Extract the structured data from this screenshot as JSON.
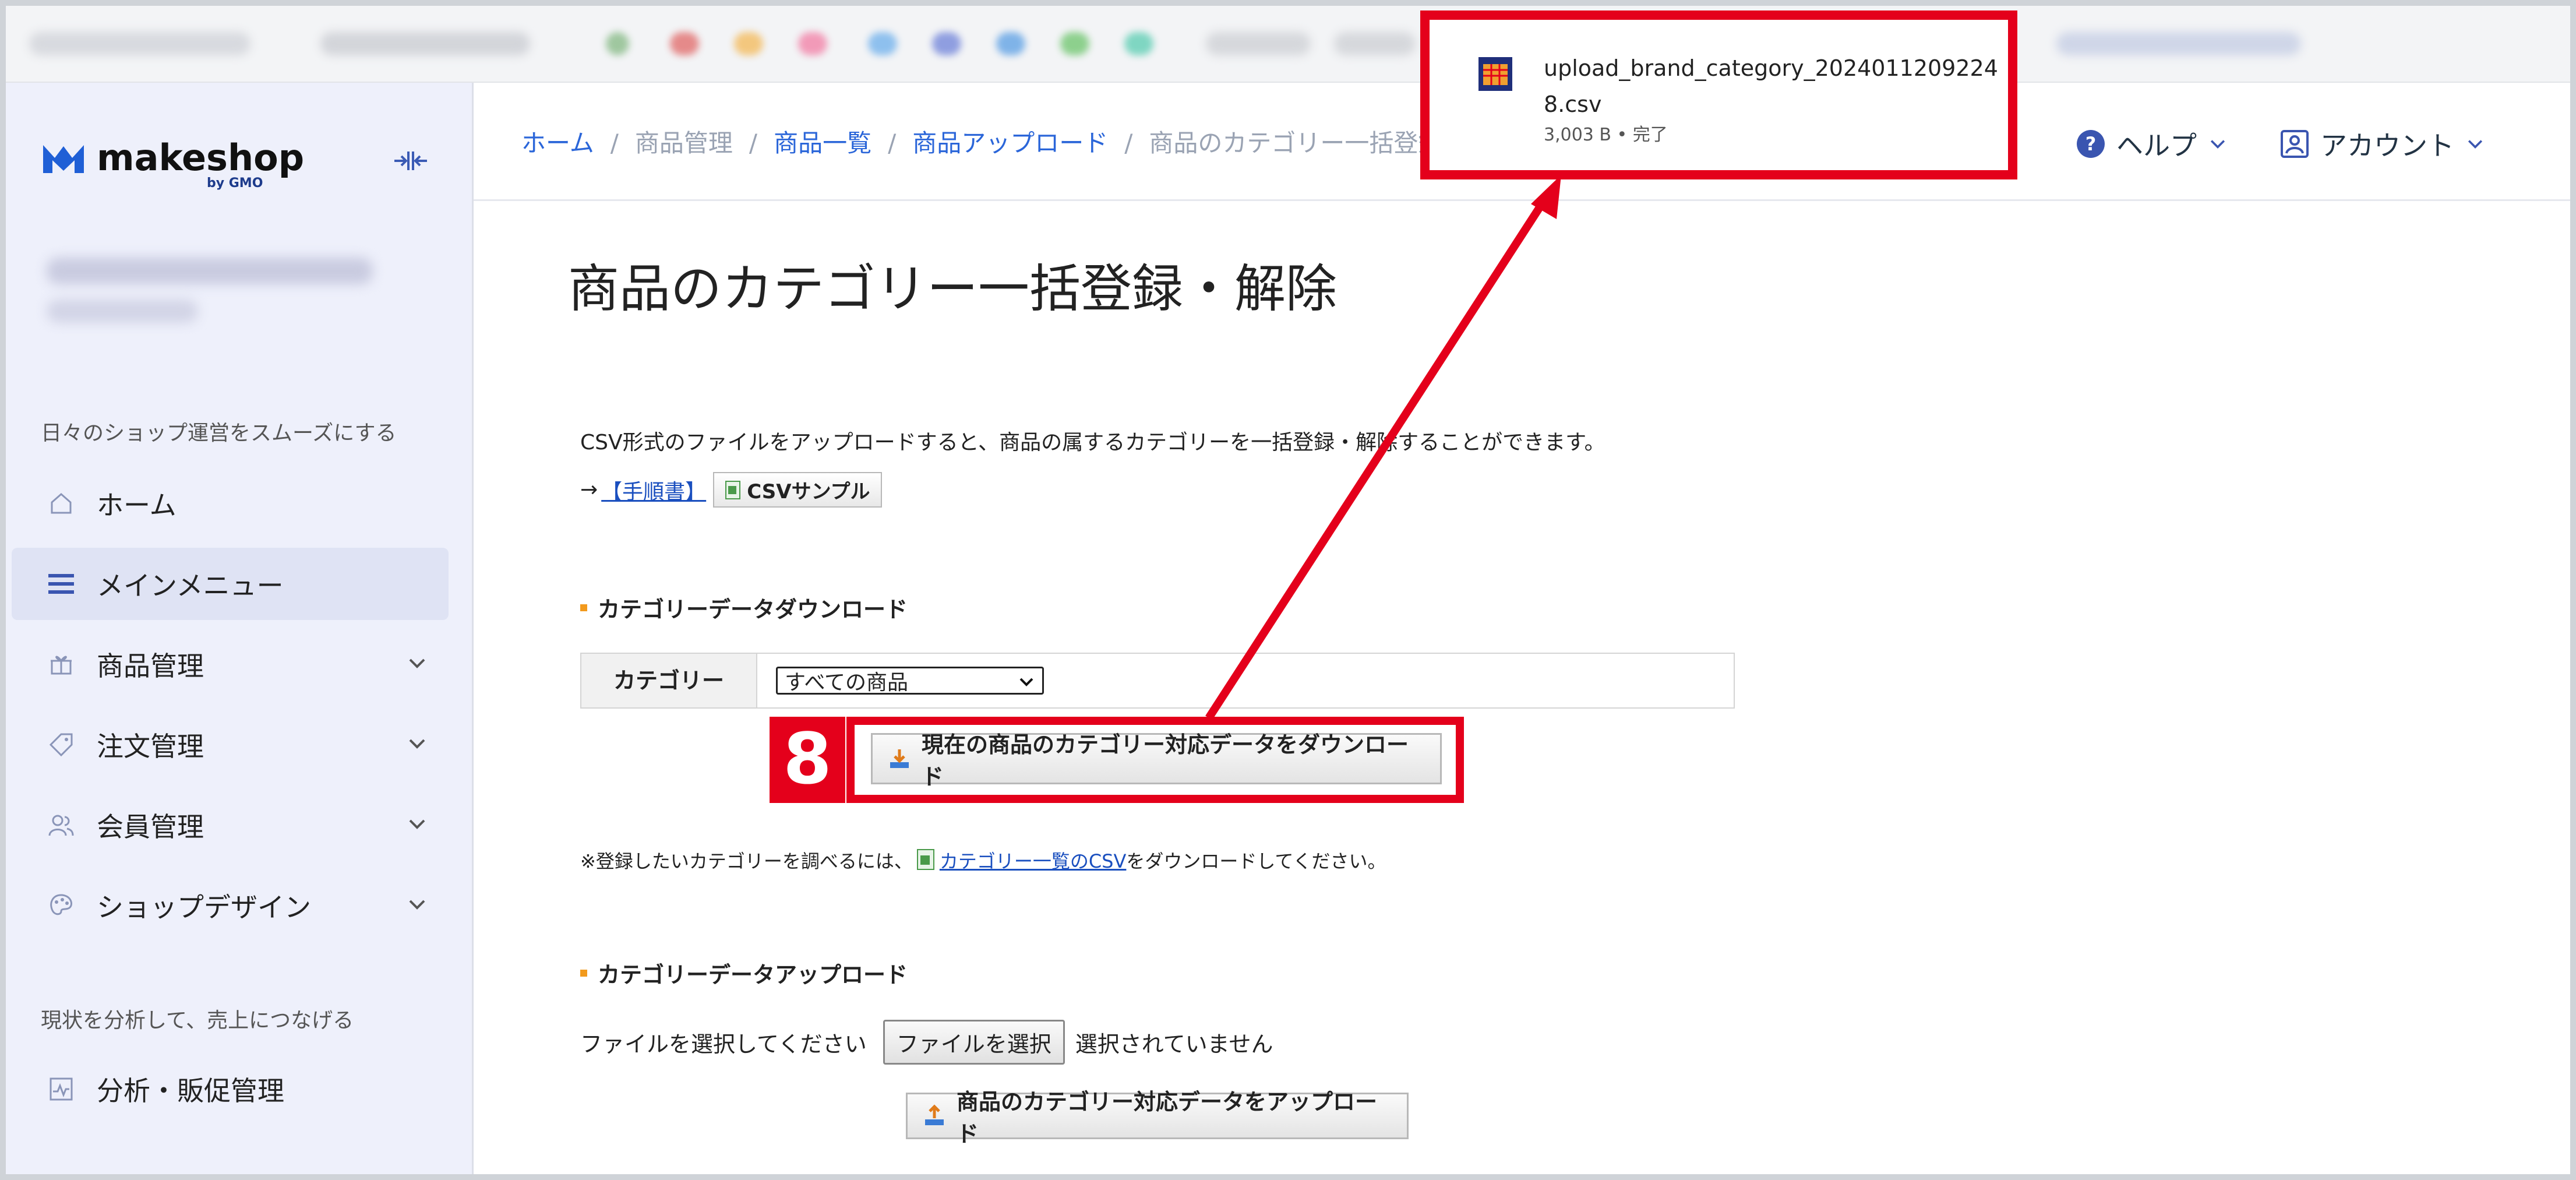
{
  "sidebar": {
    "brand": "makeshop",
    "brand_sub": "by GMO",
    "section1_title": "日々のショップ運営をスムーズにする",
    "items": [
      {
        "label": "ホーム",
        "icon": "home-icon"
      },
      {
        "label": "メインメニュー",
        "icon": "menu-icon"
      },
      {
        "label": "商品管理",
        "icon": "gift-icon"
      },
      {
        "label": "注文管理",
        "icon": "tag-icon"
      },
      {
        "label": "会員管理",
        "icon": "users-icon"
      },
      {
        "label": "ショップデザイン",
        "icon": "palette-icon"
      }
    ],
    "section2_title": "現状を分析して、売上につなげる",
    "items2": [
      {
        "label": "分析・販促管理",
        "icon": "chart-icon"
      }
    ]
  },
  "header": {
    "breadcrumb": [
      "ホーム",
      "商品管理",
      "商品一覧",
      "商品アップロード",
      "商品のカテゴリー一括登録"
    ],
    "help_label": "ヘルプ",
    "account_label": "アカウント"
  },
  "main": {
    "title": "商品のカテゴリー一括登録・解除",
    "description": "CSV形式のファイルをアップロードすると、商品の属するカテゴリーを一括登録・解除することができます。",
    "arrow": "→",
    "manual_link": "【手順書】",
    "csv_sample_button": "CSVサンプル",
    "download_section_title": "カテゴリーデータダウンロード",
    "category_label": "カテゴリー",
    "category_selected": "すべての商品",
    "download_button": "現在の商品のカテゴリー対応データをダウンロード",
    "note_prefix": "※登録したいカテゴリーを調べるには、",
    "note_link": "カテゴリー一覧のCSV",
    "note_suffix": "をダウンロードしてください。",
    "upload_section_title": "カテゴリーデータアップロード",
    "file_prompt": "ファイルを選択してください",
    "file_button": "ファイルを選択",
    "file_status": "選択されていません",
    "upload_button": "商品のカテゴリー対応データをアップロード"
  },
  "download_popup": {
    "filename": "upload_brand_category_20240112092248.csv",
    "status": "3,003 B • 完了"
  },
  "annotation": {
    "step_number": "8",
    "color": "#e4001b"
  }
}
